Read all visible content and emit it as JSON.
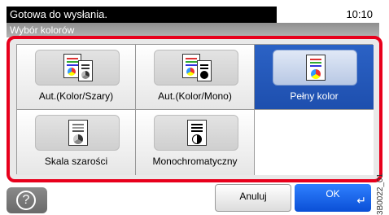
{
  "status": {
    "message": "Gotowa do wysłania.",
    "time": "10:10"
  },
  "title": "Wybór kolorów",
  "options": [
    {
      "label": "Aut.(Kolor/Szary)",
      "selected": false
    },
    {
      "label": "Aut.(Kolor/Mono)",
      "selected": false
    },
    {
      "label": "Pełny kolor",
      "selected": true
    },
    {
      "label": "Skala szarości",
      "selected": false
    },
    {
      "label": "Monochromatyczny",
      "selected": false
    }
  ],
  "buttons": {
    "cancel": "Anuluj",
    "ok": "OK",
    "help_symbol": "?"
  },
  "watermark": "3B0022_01",
  "colors": {
    "accent_border": "#e8001c",
    "selected": "#1e4fae",
    "ok_button": "#0a4fd6"
  }
}
